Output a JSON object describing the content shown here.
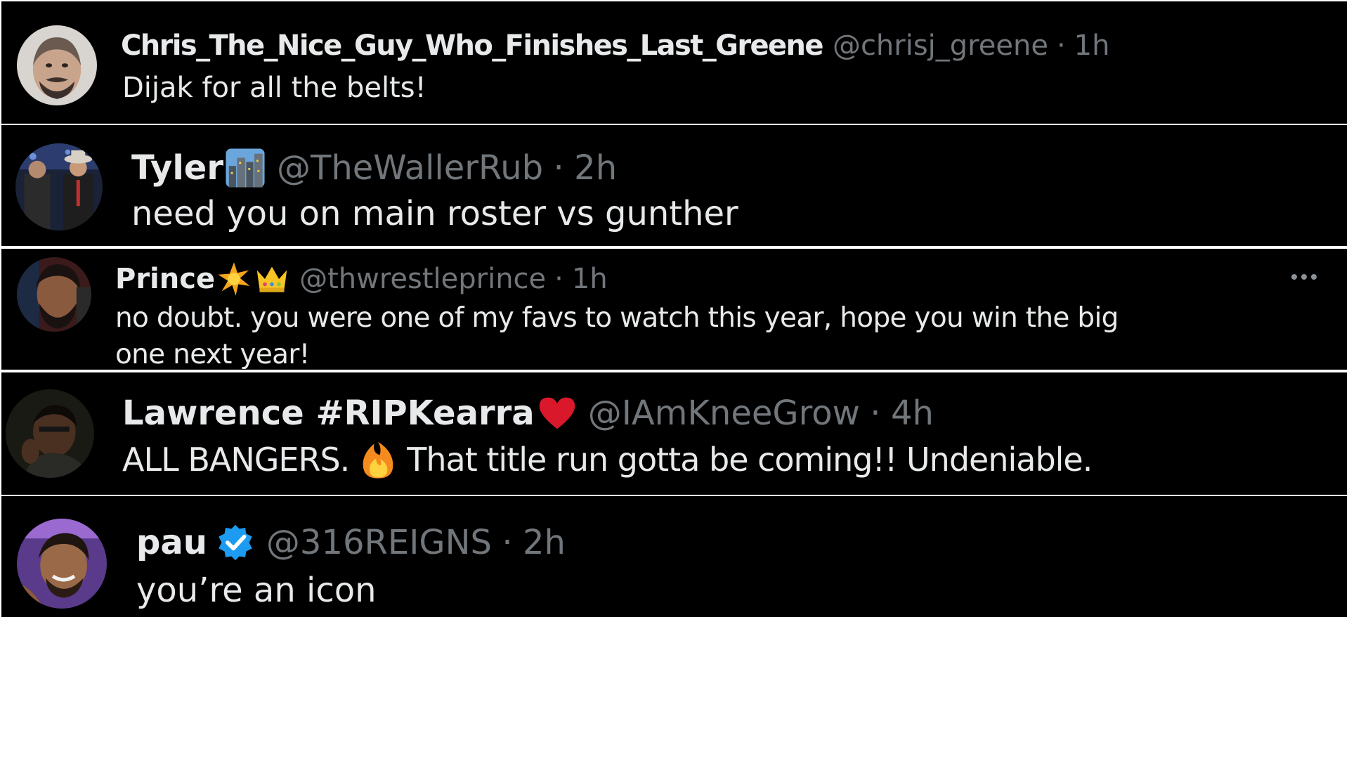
{
  "tweets": [
    {
      "display_name": "Chris_The_Nice_Guy_Who_Finishes_Last_Greene",
      "handle": "@chrisj_greene",
      "separator": "·",
      "time": "1h",
      "text": "Dijak for all the belts!"
    },
    {
      "display_name": "Tyler",
      "handle": "@TheWallerRub",
      "separator": "·",
      "time": "2h",
      "text": "need you on main roster vs gunther",
      "emoji": "city-skyline-icon"
    },
    {
      "display_name": "Prince",
      "handle": "@thwrestleprince",
      "separator": "·",
      "time": "1h",
      "text_line1": "no doubt. you were one of my favs to watch this year, hope you win the big",
      "text_line2": "one next year!",
      "emoji": [
        "sparkle-star-icon",
        "crown-icon"
      ]
    },
    {
      "display_name": "Lawrence #RIPKearra",
      "handle": "@IAmKneeGrow",
      "separator": "·",
      "time": "4h",
      "text_before": "ALL BANGERS.",
      "text_after": "That title run gotta be coming!! Undeniable.",
      "emoji": [
        "red-heart-icon",
        "fire-icon"
      ]
    },
    {
      "display_name": "pau",
      "handle": "@316REIGNS",
      "separator": "·",
      "time": "2h",
      "text": "you’re an icon",
      "badge": "verified-badge-icon"
    }
  ],
  "colors": {
    "background": "#000000",
    "name": "#e7e9ea",
    "handle": "#71767b",
    "verified": "#1d9bf0",
    "heart": "#d9182b"
  }
}
